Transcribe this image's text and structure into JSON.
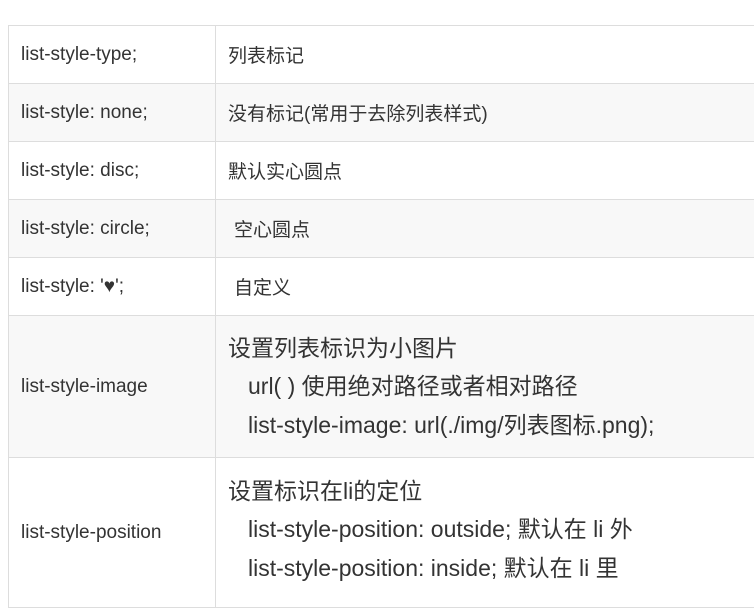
{
  "rows": [
    {
      "key": "list-style-type;",
      "value": "列表标记"
    },
    {
      "key": "list-style: none;",
      "value": "没有标记(常用于去除列表样式)"
    },
    {
      "key": "list-style: disc;",
      "value": "默认实心圆点"
    },
    {
      "key": "list-style: circle;",
      "value": "空心圆点"
    },
    {
      "key": "list-style: '♥';",
      "value": "自定义"
    }
  ],
  "image_row": {
    "key": "list-style-image",
    "heading": "设置列表标识为小图片",
    "lines": [
      "url( ) 使用绝对路径或者相对路径",
      "list-style-image: url(./img/列表图标.png);"
    ]
  },
  "position_row": {
    "key": "list-style-position",
    "heading": "设置标识在li的定位",
    "lines": [
      "list-style-position: outside;  默认在 li 外",
      "list-style-position: inside;  默认在 li 里"
    ]
  }
}
